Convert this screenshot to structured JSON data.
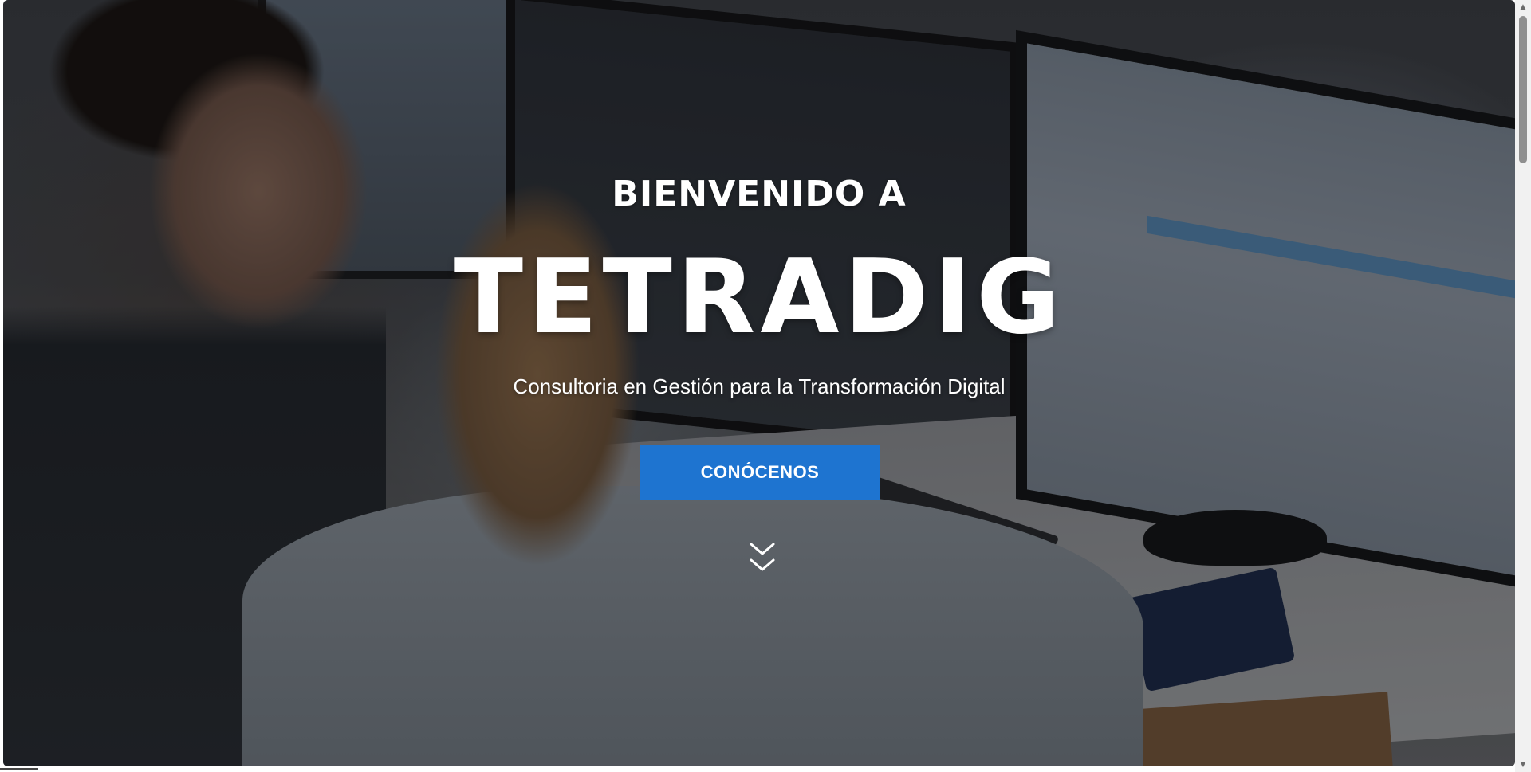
{
  "hero": {
    "kicker": "BIENVENIDO A",
    "brand": "TETRADIG",
    "tagline": "Consultoria en Gestión para la Transformación Digital",
    "cta_label": "CONÓCENOS",
    "scroll_icon": "double-chevron-down-icon"
  },
  "colors": {
    "cta_background": "#1e74d0",
    "text": "#ffffff",
    "scrollbar_track": "#f1f1f1",
    "scrollbar_thumb": "#8f8f8f"
  }
}
